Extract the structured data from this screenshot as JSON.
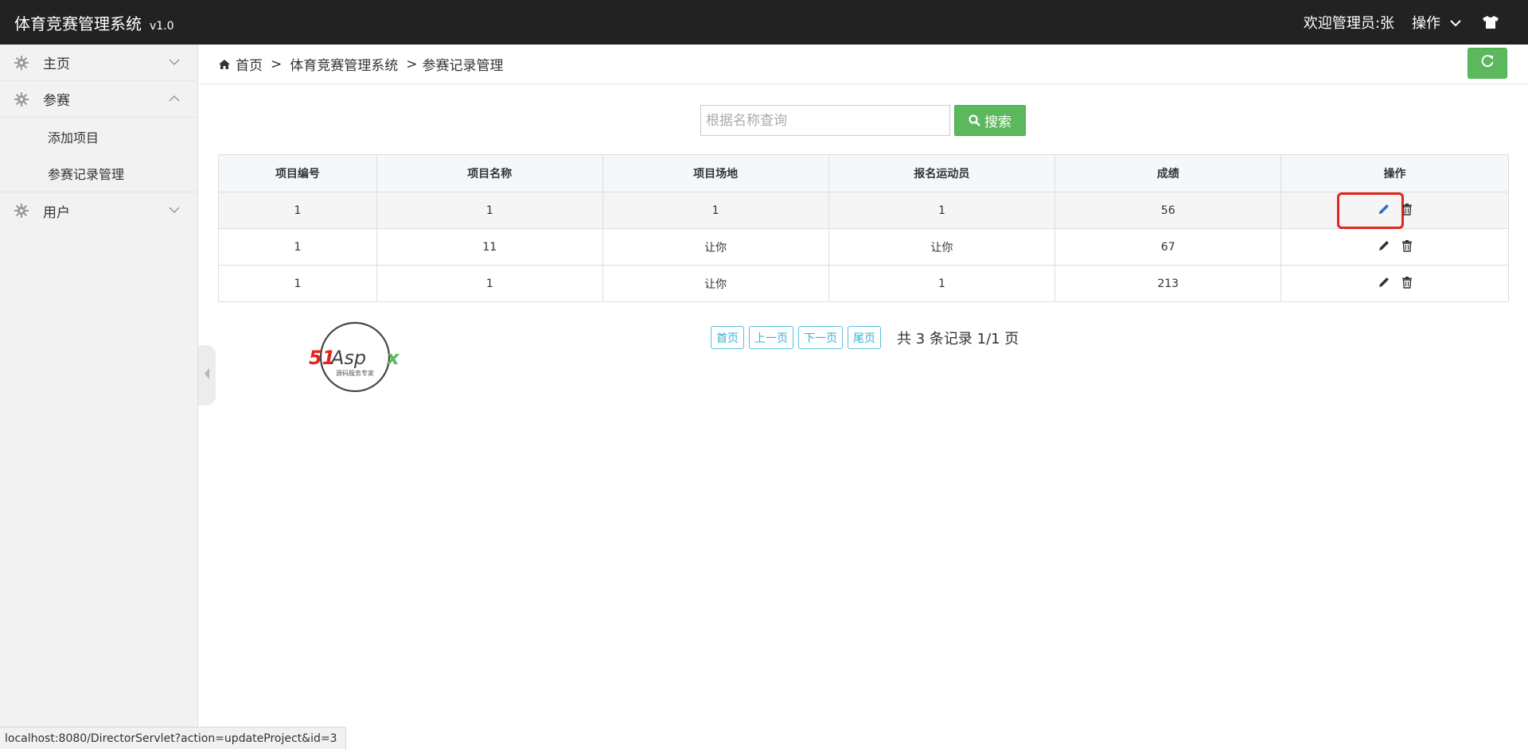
{
  "header": {
    "title": "体育竞赛管理系统",
    "version": "v1.0",
    "welcome": "欢迎管理员:张",
    "ops_label": "操作"
  },
  "sidebar": {
    "items": [
      {
        "label": "主页",
        "icon": "gear-icon",
        "expanded": false
      },
      {
        "label": "参赛",
        "icon": "gear-icon",
        "expanded": true,
        "children": [
          {
            "label": "添加项目"
          },
          {
            "label": "参赛记录管理"
          }
        ]
      },
      {
        "label": "用户",
        "icon": "gear-icon",
        "expanded": false
      }
    ]
  },
  "breadcrumb": {
    "items": [
      "首页",
      "体育竞赛管理系统",
      "参赛记录管理"
    ],
    "separator": ">"
  },
  "search": {
    "placeholder": "根据名称查询",
    "value": "",
    "button_label": "搜索"
  },
  "table": {
    "columns": [
      "项目编号",
      "项目名称",
      "项目场地",
      "报名运动员",
      "成绩",
      "操作"
    ],
    "rows": [
      [
        "1",
        "1",
        "1",
        "1",
        "56"
      ],
      [
        "1",
        "11",
        "让你",
        "让你",
        "67"
      ],
      [
        "1",
        "1",
        "让你",
        "1",
        "213"
      ]
    ]
  },
  "pagination": {
    "first": "首页",
    "prev": "上一页",
    "next": "下一页",
    "last": "尾页",
    "info": "共 3 条记录 1/1 页"
  },
  "logo": {
    "text_main": "51Aspx",
    "text_sub": "源码服务专家"
  },
  "statusbar": {
    "url": "localhost:8080/DirectorServlet?action=updateProject&id=3"
  },
  "colors": {
    "topbar": "#222222",
    "green": "#5cb85c",
    "info": "#5bc0de",
    "highlight": "#e3251d",
    "edit_active": "#2f6fd0"
  }
}
